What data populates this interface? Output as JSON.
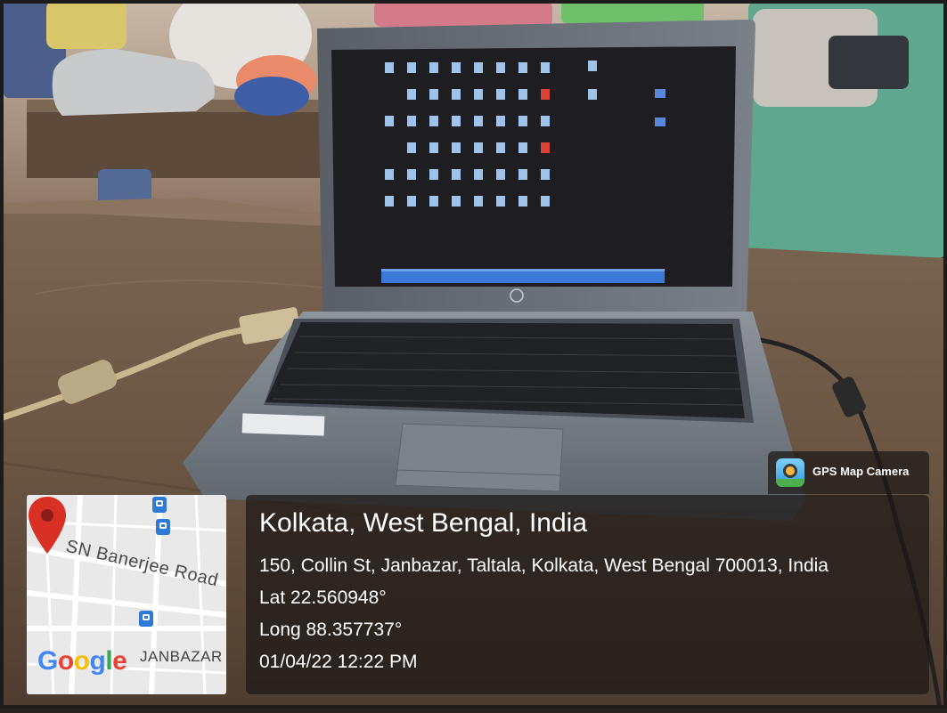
{
  "photo": {
    "description_icons": [
      "laptop",
      "table",
      "cable"
    ]
  },
  "stamp": {
    "app_name": "GPS Map Camera",
    "title": "Kolkata, West Bengal, India",
    "address": "150, Collin St, Janbazar, Taltala, Kolkata, West Bengal 700013, India",
    "latitude": "Lat 22.560948°",
    "longitude": "Long 88.357737°",
    "datetime": "01/04/22 12:22 PM"
  },
  "map": {
    "road_label": "SN Banerjee Road",
    "area_label": "JANBAZAR",
    "provider": "Google",
    "pin_color": "#d93025",
    "metro_color": "#2f7ad6"
  },
  "colors": {
    "table": "#6e5a48",
    "laptop_body": "#6b7078",
    "screen": "#1e1d22",
    "taskbar": "#3c78d8"
  }
}
